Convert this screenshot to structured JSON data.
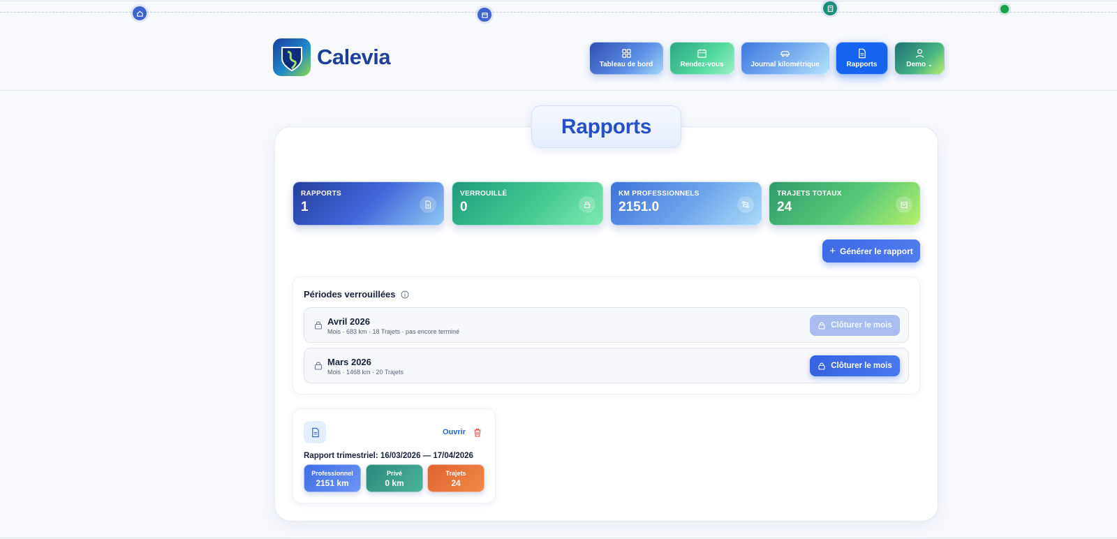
{
  "app": {
    "name": "Calevia"
  },
  "nav": {
    "items": [
      {
        "label": "Tableau de bord",
        "icon": "grid-icon"
      },
      {
        "label": "Rendez-vous",
        "icon": "calendar-icon"
      },
      {
        "label": "Journal kilométrique",
        "icon": "car-icon"
      },
      {
        "label": "Rapports",
        "icon": "document-icon",
        "active": true
      },
      {
        "label": "Demo",
        "icon": "user-icon"
      }
    ]
  },
  "page": {
    "title": "Rapports"
  },
  "stats": [
    {
      "label": "RAPPORTS",
      "value": "1",
      "icon": "document-icon"
    },
    {
      "label": "VERROUILLÉ",
      "value": "0",
      "icon": "lock-icon"
    },
    {
      "label": "KM PROFESSIONNELS",
      "value": "2151.0",
      "icon": "route-icon"
    },
    {
      "label": "TRAJETS TOTAUX",
      "value": "24",
      "icon": "calendar-icon"
    }
  ],
  "actions": {
    "generate_label": "Générer le rapport"
  },
  "periods": {
    "title": "Périodes verrouillées",
    "rows": [
      {
        "name": "Avril 2026",
        "meta": "Mois · 683 km · 18 Trajets · pas encore terminé",
        "button": "Clôturer le mois",
        "disabled": true
      },
      {
        "name": "Mars 2026",
        "meta": "Mois · 1468 km · 20 Trajets",
        "button": "Clôturer le mois",
        "disabled": false
      }
    ]
  },
  "report": {
    "open_label": "Ouvrir",
    "title": "Rapport trimestriel: 16/03/2026 — 17/04/2026",
    "chips": [
      {
        "label": "Professionnel",
        "value": "2151 km"
      },
      {
        "label": "Privé",
        "value": "0 km"
      },
      {
        "label": "Trajets",
        "value": "24"
      }
    ]
  },
  "colors": {
    "accent": "#1663f0",
    "title": "#2451c7",
    "danger": "#e04343"
  }
}
